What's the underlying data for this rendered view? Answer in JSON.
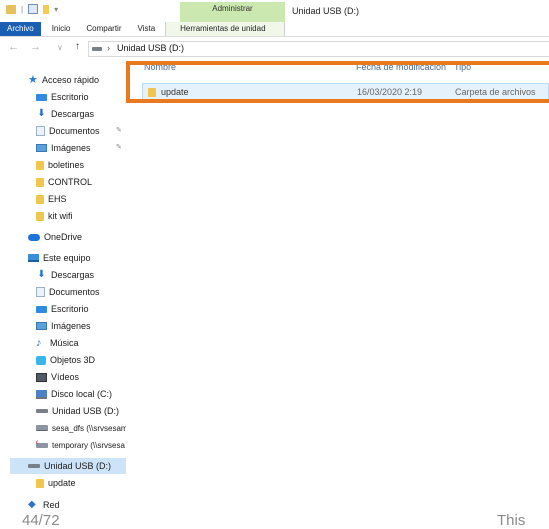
{
  "window": {
    "title": "Unidad USB (D:)",
    "contextual_group": "Administrar"
  },
  "ribbon": {
    "tabs": [
      {
        "label": "Archivo",
        "active": true
      },
      {
        "label": "Inicio"
      },
      {
        "label": "Compartir"
      },
      {
        "label": "Vista"
      },
      {
        "label": "Herramientas de unidad",
        "contextual": true
      }
    ]
  },
  "address": {
    "path": "Unidad USB (D:)",
    "icon": "usb-drive-icon"
  },
  "nav": {
    "quick_access": {
      "label": "Acceso rápido",
      "items": [
        {
          "label": "Escritorio",
          "icon": "desktop-icon"
        },
        {
          "label": "Descargas",
          "icon": "downloads-icon"
        },
        {
          "label": "Documentos",
          "icon": "documents-icon",
          "pinned": true
        },
        {
          "label": "Imágenes",
          "icon": "pictures-icon",
          "pinned": true
        },
        {
          "label": "boletines",
          "icon": "folder-icon"
        },
        {
          "label": "CONTROL",
          "icon": "folder-icon"
        },
        {
          "label": "EHS",
          "icon": "folder-icon"
        },
        {
          "label": "kit wifi",
          "icon": "folder-icon"
        }
      ]
    },
    "onedrive": {
      "label": "OneDrive"
    },
    "this_pc": {
      "label": "Este equipo",
      "items": [
        {
          "label": "Descargas",
          "icon": "downloads-icon"
        },
        {
          "label": "Documentos",
          "icon": "documents-icon"
        },
        {
          "label": "Escritorio",
          "icon": "desktop-icon"
        },
        {
          "label": "Imágenes",
          "icon": "pictures-icon"
        },
        {
          "label": "Música",
          "icon": "music-icon"
        },
        {
          "label": "Objetos 3D",
          "icon": "objects-3d-icon"
        },
        {
          "label": "Vídeos",
          "icon": "videos-icon"
        },
        {
          "label": "Disco local (C:)",
          "icon": "local-disk-icon"
        },
        {
          "label": "Unidad USB (D:)",
          "icon": "usb-drive-icon"
        },
        {
          "label": "sesa_dfs (\\\\srvsesam",
          "icon": "network-drive-icon"
        },
        {
          "label": "temporary (\\\\srvsesa",
          "icon": "disconnected-drive-icon"
        }
      ]
    },
    "usb": {
      "label": "Unidad USB (D:)",
      "items": [
        {
          "label": "update",
          "icon": "folder-icon"
        }
      ]
    },
    "network": {
      "label": "Red"
    }
  },
  "file_list": {
    "columns": [
      "Nombre",
      "Fecha de modificación",
      "Tipo"
    ],
    "rows": [
      {
        "name": "update",
        "date": "16/03/2020 2:19",
        "type": "Carpeta de archivos"
      }
    ],
    "highlight_color": "#e8791f"
  },
  "footer": {
    "page": "44/72",
    "right_text": "This"
  }
}
